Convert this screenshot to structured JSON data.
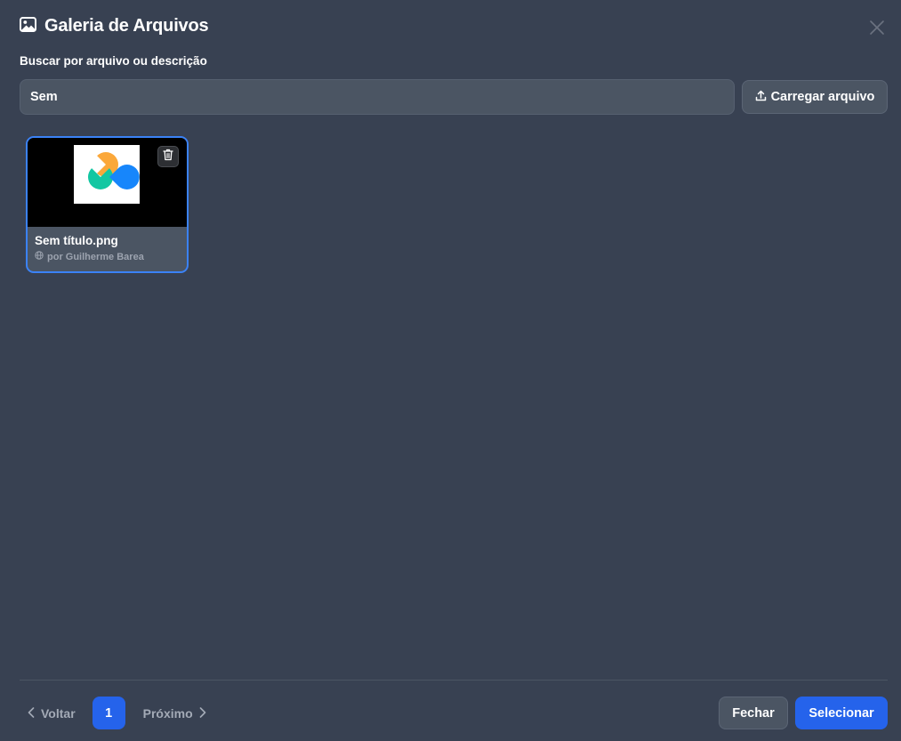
{
  "dialog": {
    "title": "Galeria de Arquivos",
    "title_icon": "image-icon",
    "close_icon": "close-icon"
  },
  "search": {
    "label": "Buscar por arquivo ou descrição",
    "value": "Sem",
    "placeholder": ""
  },
  "upload": {
    "label": "Carregar arquivo",
    "icon": "upload-icon"
  },
  "files": [
    {
      "name": "Sem título.png",
      "owner": "por Guilherme Barea",
      "owner_icon": "globe-icon",
      "delete_icon": "trash-icon",
      "selected": true
    }
  ],
  "pagination": {
    "prev_label": "Voltar",
    "current_page": "1",
    "next_label": "Próximo"
  },
  "footer": {
    "close_label": "Fechar",
    "select_label": "Selecionar"
  },
  "colors": {
    "background": "#384152",
    "accent": "#2563eb",
    "selected_border": "#3b82f6",
    "logo_orange": "#FBA83A",
    "logo_teal": "#13C7A2",
    "logo_blue": "#1786FB"
  }
}
